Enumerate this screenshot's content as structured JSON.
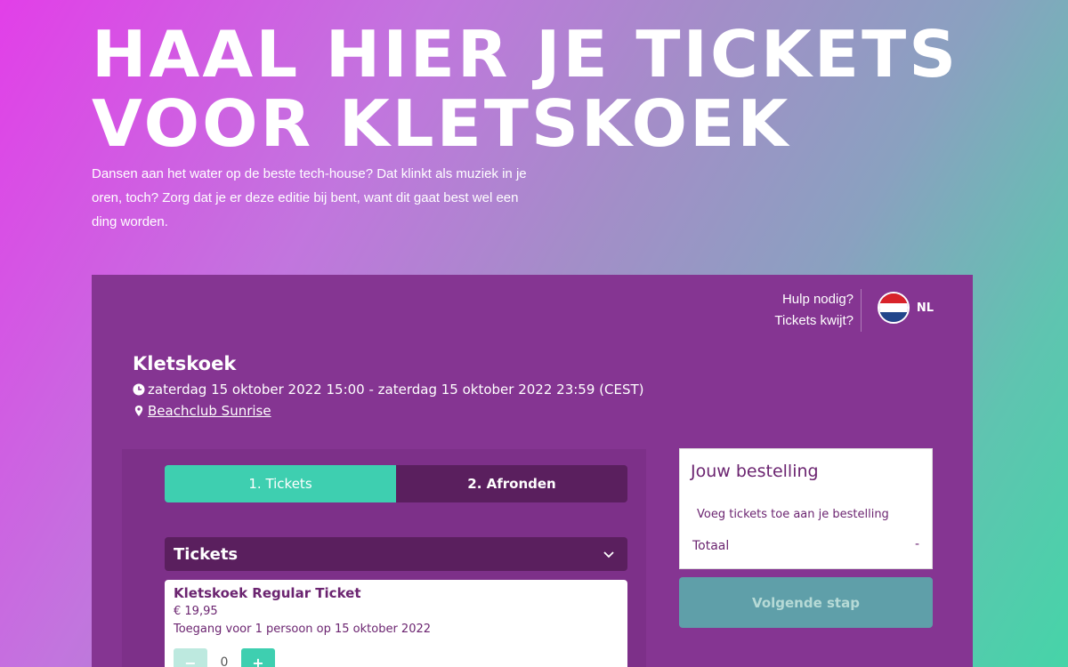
{
  "hero": {
    "title_line1": "HAAL HIER JE TICKETS",
    "title_line2": "VOOR KLETSKOEK",
    "intro": "Dansen aan het water op de beste tech-house? Dat klinkt als muziek in je oren, toch? Zorg dat je er deze editie bij bent, want dit gaat best wel een ding worden."
  },
  "widget": {
    "help": {
      "help_link": "Hulp nodig?",
      "lost_link": "Tickets kwijt?"
    },
    "language": {
      "code": "NL",
      "flag_icon": "netherlands-flag-icon",
      "flag_colors": [
        "#d8232a",
        "#ffffff",
        "#21468b"
      ]
    },
    "event": {
      "name": "Kletskoek",
      "date": "zaterdag 15 oktober 2022 15:00 - zaterdag 15 oktober 2022 23:59 (CEST)",
      "location": "Beachclub Sunrise",
      "date_icon": "clock-icon",
      "location_icon": "map-pin-icon"
    },
    "steps": [
      {
        "label": "1. Tickets",
        "active": true
      },
      {
        "label": "2. Afronden",
        "active": false
      }
    ],
    "tickets_section": {
      "title": "Tickets",
      "chevron_icon": "chevron-down-icon"
    },
    "ticket": {
      "name": "Kletskoek Regular Ticket",
      "price": "€ 19,95",
      "description": "Toegang voor 1 persoon op 15 oktober 2022",
      "quantity": "0",
      "minus_label": "−",
      "plus_label": "+"
    },
    "order": {
      "title": "Jouw bestelling",
      "hint": "Voeg tickets toe aan je bestelling",
      "total_label": "Totaal",
      "total_value": "-"
    },
    "next_button": "Volgende stap"
  },
  "colors": {
    "widget_bg": "#853592",
    "accent_teal": "#3ecfb0",
    "dark_purple": "#5a1f5e",
    "disabled_button": "#5f9fa9"
  }
}
